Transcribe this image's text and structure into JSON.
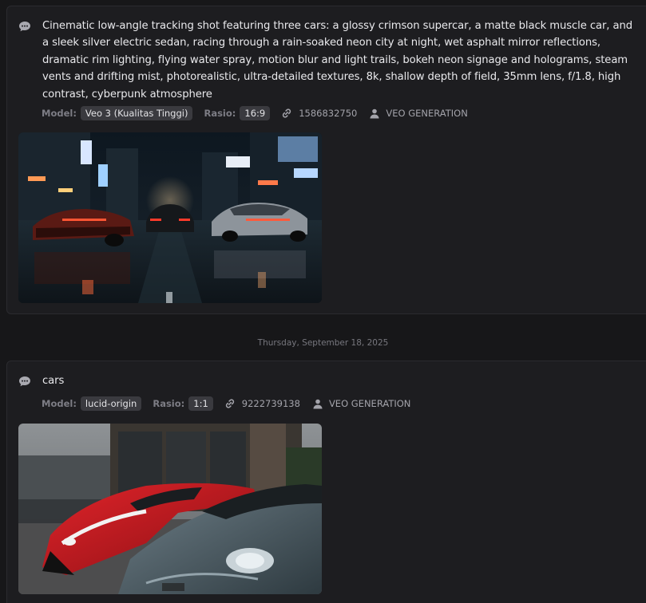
{
  "date_separator": "Thursday, September 18, 2025",
  "generations": [
    {
      "prompt": "Cinematic low-angle tracking shot featuring three cars: a glossy crimson supercar, a matte black muscle car, and a sleek silver electric sedan, racing through a rain-soaked neon city at night, wet asphalt mirror reflections, dramatic rim lighting, flying water spray, motion blur and light trails, bokeh neon signage and holograms, steam vents and drifting mist, photorealistic, ultra-detailed textures, 8k, shallow depth of field, 35mm lens, f/1.8, high contrast, cyberpunk atmosphere",
      "model_label": "Model:",
      "model": "Veo 3 (Kualitas Tinggi)",
      "ratio_label": "Rasio:",
      "ratio": "16:9",
      "seed": "1586832750",
      "source": "VEO GENERATION"
    },
    {
      "prompt": "cars",
      "model_label": "Model:",
      "model": "lucid-origin",
      "ratio_label": "Rasio:",
      "ratio": "1:1",
      "seed": "9222739138",
      "source": "VEO GENERATION"
    }
  ],
  "icons": {
    "prompt": "chat-bubble-icon",
    "seed": "link-icon",
    "source": "user-icon"
  }
}
